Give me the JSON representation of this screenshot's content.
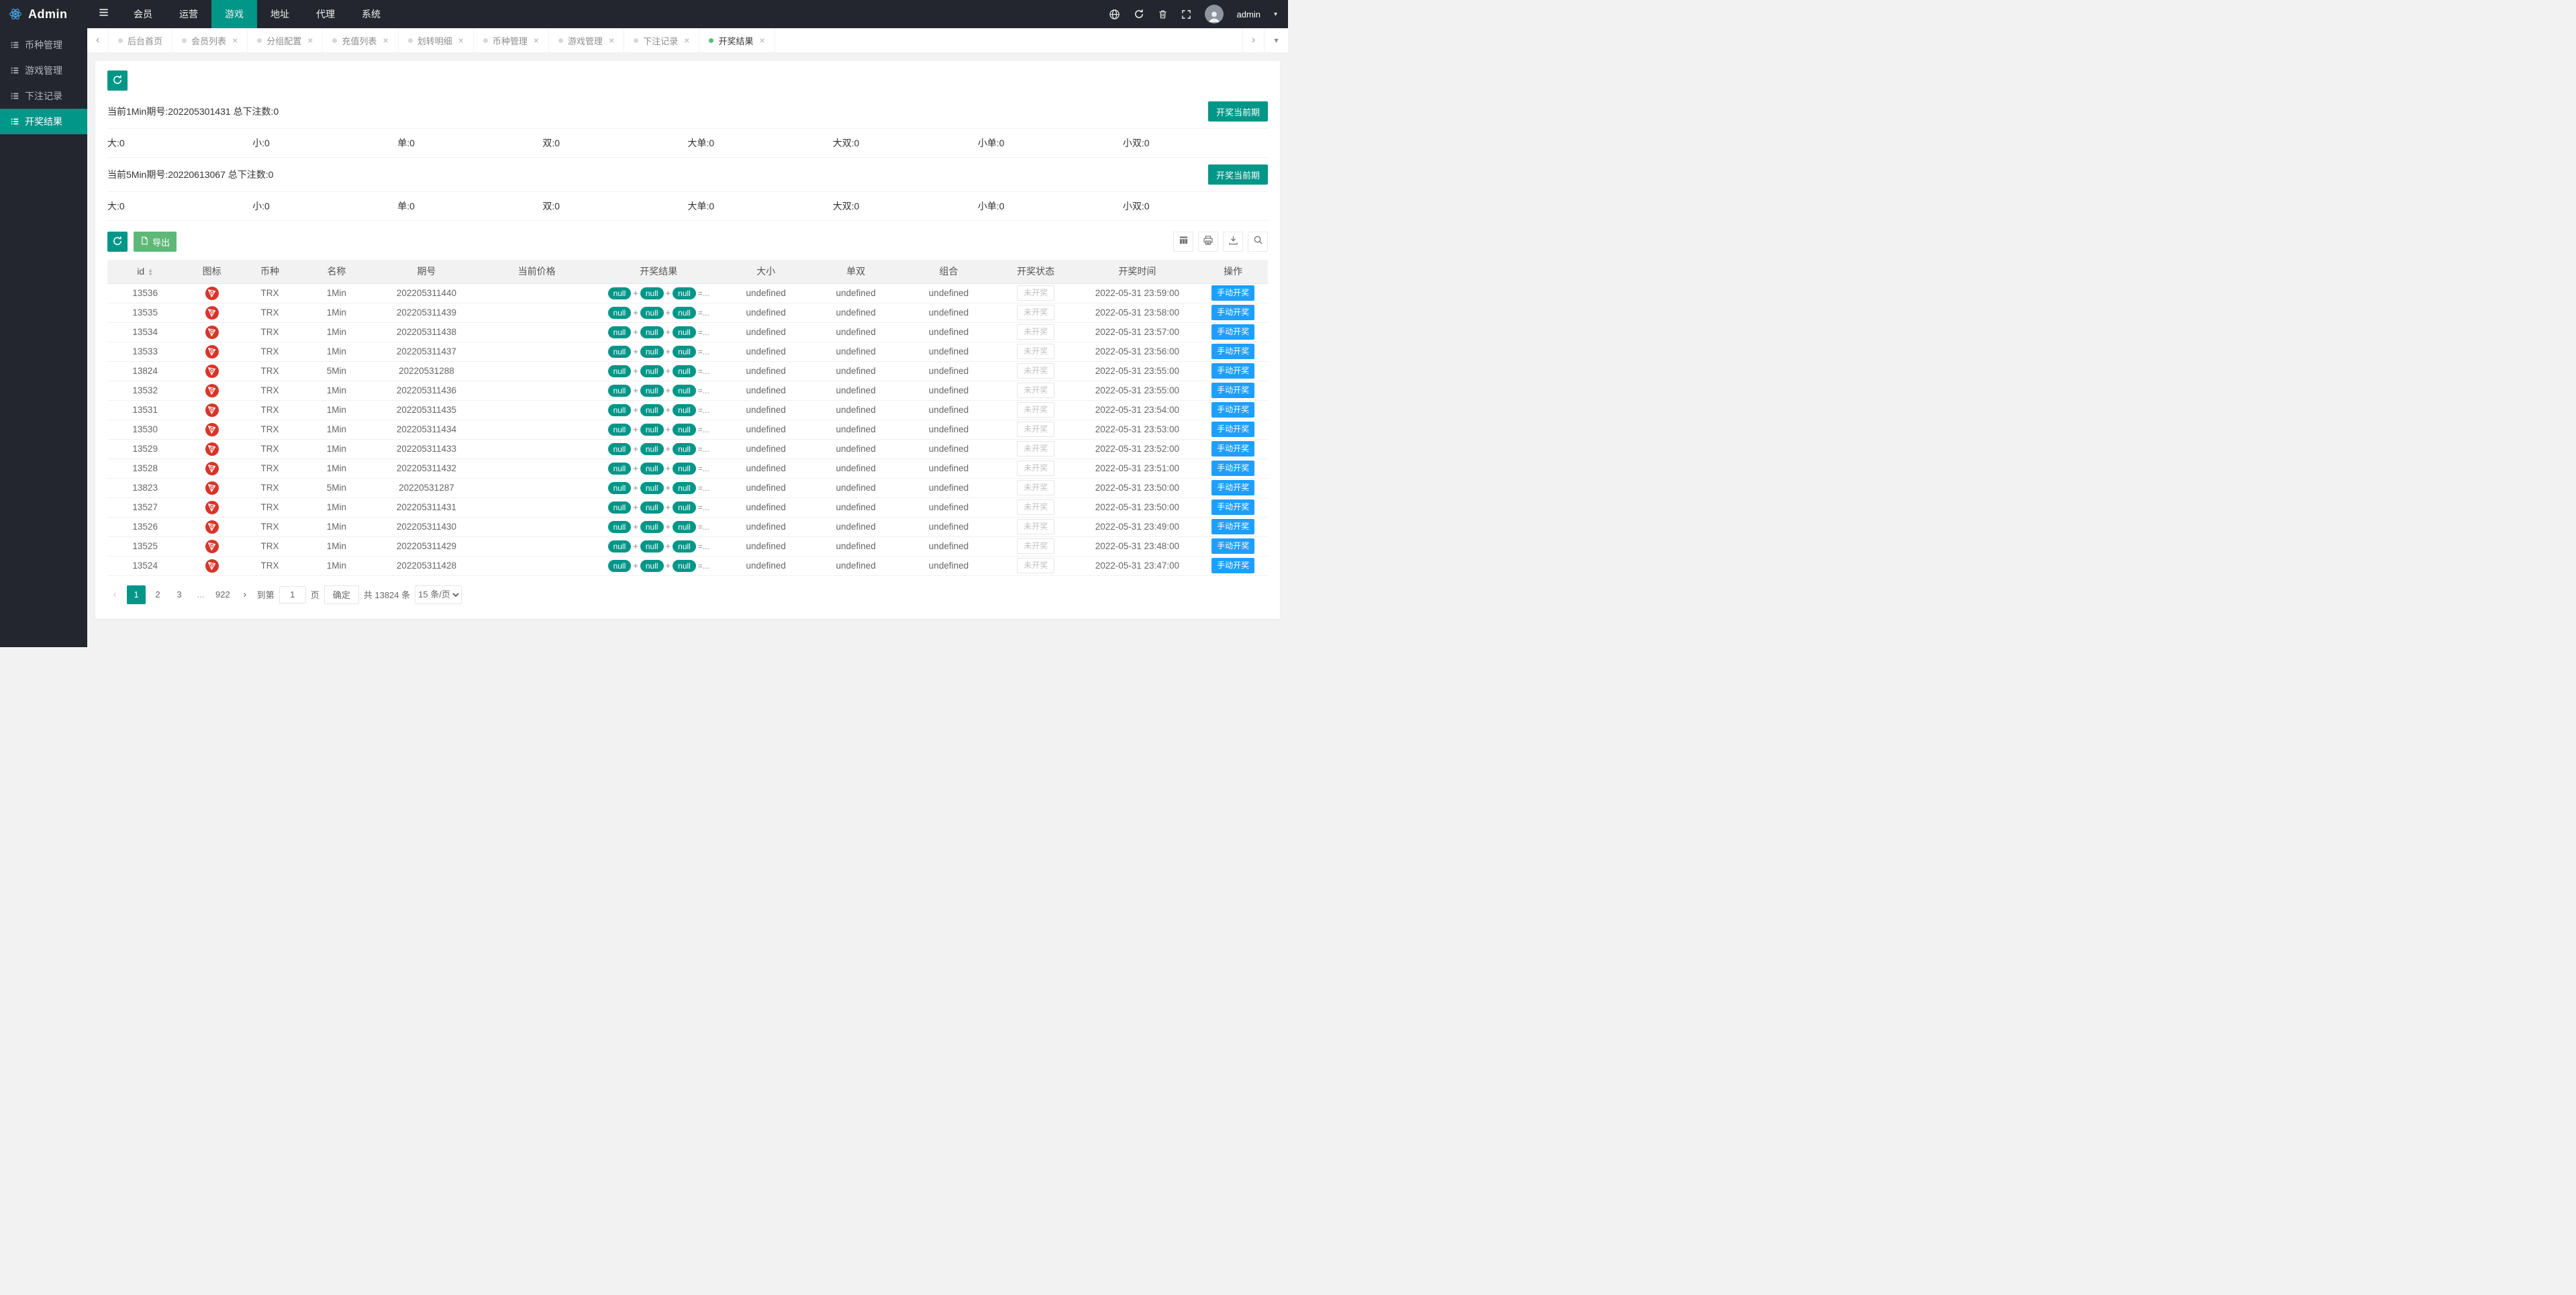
{
  "icons": {
    "close": "×",
    "caret_down": "▾",
    "chevron_left": "‹",
    "chevron_right": "›",
    "sort_asc": "▲",
    "sort_desc": "▼",
    "plus": "+"
  },
  "colors": {
    "primary_teal": "#009688",
    "green": "#5FB878",
    "blue": "#1E9FFF",
    "topbar_bg": "#23262e",
    "tron_red": "#d8352a"
  },
  "topbar": {
    "brand": "Admin",
    "nav_items": [
      {
        "label": "会员",
        "active": false
      },
      {
        "label": "运营",
        "active": false
      },
      {
        "label": "游戏",
        "active": true
      },
      {
        "label": "地址",
        "active": false
      },
      {
        "label": "代理",
        "active": false
      },
      {
        "label": "系统",
        "active": false
      }
    ],
    "username": "admin"
  },
  "sidebar": {
    "items": [
      {
        "label": "币种管理",
        "active": false
      },
      {
        "label": "游戏管理",
        "active": false
      },
      {
        "label": "下注记录",
        "active": false
      },
      {
        "label": "开奖结果",
        "active": true
      }
    ]
  },
  "tabs": [
    {
      "label": "后台首页",
      "active": false,
      "closable": false
    },
    {
      "label": "会员列表",
      "active": false,
      "closable": true
    },
    {
      "label": "分组配置",
      "active": false,
      "closable": true
    },
    {
      "label": "充值列表",
      "active": false,
      "closable": true
    },
    {
      "label": "划转明细",
      "active": false,
      "closable": true
    },
    {
      "label": "币种管理",
      "active": false,
      "closable": true
    },
    {
      "label": "游戏管理",
      "active": false,
      "closable": true
    },
    {
      "label": "下注记录",
      "active": false,
      "closable": true
    },
    {
      "label": "开奖结果",
      "active": true,
      "closable": true
    }
  ],
  "panels": [
    {
      "title": "当前1Min期号:202205301431 总下注数:0",
      "button": "开奖当前期",
      "stats": [
        "大:0",
        "小:0",
        "单:0",
        "双:0",
        "大单:0",
        "大双:0",
        "小单:0",
        "小双:0"
      ]
    },
    {
      "title": "当前5Min期号:20220613067 总下注数:0",
      "button": "开奖当前期",
      "stats": [
        "大:0",
        "小:0",
        "单:0",
        "双:0",
        "大单:0",
        "大双:0",
        "小单:0",
        "小双:0"
      ]
    }
  ],
  "toolbar": {
    "export_label": "导出"
  },
  "table": {
    "columns": [
      "id",
      "图标",
      "币种",
      "名称",
      "期号",
      "当前价格",
      "开奖结果",
      "大小",
      "单双",
      "组合",
      "开奖状态",
      "开奖时间",
      "操作"
    ],
    "result_pills": [
      "null",
      "null",
      "null"
    ],
    "result_suffix": "=...",
    "status_label": "未开奖",
    "action_label": "手动开奖",
    "rows": [
      {
        "id": "13536",
        "coin": "TRX",
        "name": "1Min",
        "period": "202205311440",
        "price": "",
        "size": "undefined",
        "parity": "undefined",
        "combo": "undefined",
        "time": "2022-05-31 23:59:00"
      },
      {
        "id": "13535",
        "coin": "TRX",
        "name": "1Min",
        "period": "202205311439",
        "price": "",
        "size": "undefined",
        "parity": "undefined",
        "combo": "undefined",
        "time": "2022-05-31 23:58:00"
      },
      {
        "id": "13534",
        "coin": "TRX",
        "name": "1Min",
        "period": "202205311438",
        "price": "",
        "size": "undefined",
        "parity": "undefined",
        "combo": "undefined",
        "time": "2022-05-31 23:57:00"
      },
      {
        "id": "13533",
        "coin": "TRX",
        "name": "1Min",
        "period": "202205311437",
        "price": "",
        "size": "undefined",
        "parity": "undefined",
        "combo": "undefined",
        "time": "2022-05-31 23:56:00"
      },
      {
        "id": "13824",
        "coin": "TRX",
        "name": "5Min",
        "period": "20220531288",
        "price": "",
        "size": "undefined",
        "parity": "undefined",
        "combo": "undefined",
        "time": "2022-05-31 23:55:00"
      },
      {
        "id": "13532",
        "coin": "TRX",
        "name": "1Min",
        "period": "202205311436",
        "price": "",
        "size": "undefined",
        "parity": "undefined",
        "combo": "undefined",
        "time": "2022-05-31 23:55:00"
      },
      {
        "id": "13531",
        "coin": "TRX",
        "name": "1Min",
        "period": "202205311435",
        "price": "",
        "size": "undefined",
        "parity": "undefined",
        "combo": "undefined",
        "time": "2022-05-31 23:54:00"
      },
      {
        "id": "13530",
        "coin": "TRX",
        "name": "1Min",
        "period": "202205311434",
        "price": "",
        "size": "undefined",
        "parity": "undefined",
        "combo": "undefined",
        "time": "2022-05-31 23:53:00"
      },
      {
        "id": "13529",
        "coin": "TRX",
        "name": "1Min",
        "period": "202205311433",
        "price": "",
        "size": "undefined",
        "parity": "undefined",
        "combo": "undefined",
        "time": "2022-05-31 23:52:00"
      },
      {
        "id": "13528",
        "coin": "TRX",
        "name": "1Min",
        "period": "202205311432",
        "price": "",
        "size": "undefined",
        "parity": "undefined",
        "combo": "undefined",
        "time": "2022-05-31 23:51:00"
      },
      {
        "id": "13823",
        "coin": "TRX",
        "name": "5Min",
        "period": "20220531287",
        "price": "",
        "size": "undefined",
        "parity": "undefined",
        "combo": "undefined",
        "time": "2022-05-31 23:50:00"
      },
      {
        "id": "13527",
        "coin": "TRX",
        "name": "1Min",
        "period": "202205311431",
        "price": "",
        "size": "undefined",
        "parity": "undefined",
        "combo": "undefined",
        "time": "2022-05-31 23:50:00"
      },
      {
        "id": "13526",
        "coin": "TRX",
        "name": "1Min",
        "period": "202205311430",
        "price": "",
        "size": "undefined",
        "parity": "undefined",
        "combo": "undefined",
        "time": "2022-05-31 23:49:00"
      },
      {
        "id": "13525",
        "coin": "TRX",
        "name": "1Min",
        "period": "202205311429",
        "price": "",
        "size": "undefined",
        "parity": "undefined",
        "combo": "undefined",
        "time": "2022-05-31 23:48:00"
      },
      {
        "id": "13524",
        "coin": "TRX",
        "name": "1Min",
        "period": "202205311428",
        "price": "",
        "size": "undefined",
        "parity": "undefined",
        "combo": "undefined",
        "time": "2022-05-31 23:47:00"
      }
    ]
  },
  "pagination": {
    "pages": [
      "1",
      "2",
      "3",
      "...",
      "922"
    ],
    "active_page": "1",
    "jump_prefix": "到第",
    "jump_value": "1",
    "jump_suffix": "页",
    "confirm_label": "确定",
    "total_label": "共 13824 条",
    "page_size_label": "15 条/页"
  }
}
